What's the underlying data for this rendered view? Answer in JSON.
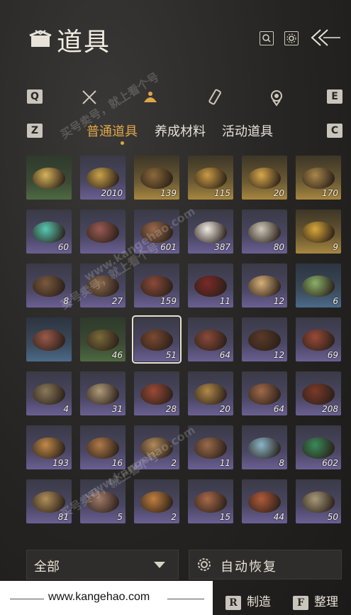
{
  "header": {
    "title": "道具",
    "icons": [
      "inventory-box-icon",
      "search-icon",
      "gear-icon",
      "back-arrow-icon"
    ]
  },
  "categories": {
    "left_key": "Q",
    "right_key": "E",
    "icons": [
      "crossed-swords-icon",
      "pot-icon",
      "scroll-brush-icon",
      "medal-icon"
    ],
    "active_index": 1
  },
  "tabs": {
    "left_key": "Z",
    "right_key": "C",
    "items": [
      "普通道具",
      "养成材料",
      "活动道具"
    ],
    "active_index": 0
  },
  "items": [
    {
      "color": "green",
      "count": "",
      "food": "#d6b35a"
    },
    {
      "color": "purple",
      "count": "2010",
      "food": "#c9a24a"
    },
    {
      "color": "gold",
      "count": "139",
      "food": "#8a6a3a"
    },
    {
      "color": "gold",
      "count": "115",
      "food": "#c89b45"
    },
    {
      "color": "gold",
      "count": "20",
      "food": "#d8a94a"
    },
    {
      "color": "gold",
      "count": "170",
      "food": "#a8874a"
    },
    {
      "color": "purple",
      "count": "60",
      "food": "#58c9b4"
    },
    {
      "color": "purple",
      "count": "",
      "food": "#9a5a55"
    },
    {
      "color": "purple",
      "count": "601",
      "food": "#9a6a4a"
    },
    {
      "color": "purple",
      "count": "387",
      "food": "#eeeae2"
    },
    {
      "color": "purple",
      "count": "80",
      "food": "#cfc8b8"
    },
    {
      "color": "gold",
      "count": "9",
      "food": "#d9a83a"
    },
    {
      "color": "purple",
      "count": "8",
      "food": "#7a5a3e"
    },
    {
      "color": "purple",
      "count": "27",
      "food": "#8a6a4e"
    },
    {
      "color": "purple",
      "count": "159",
      "food": "#8a4a3a"
    },
    {
      "color": "purple",
      "count": "11",
      "food": "#7a2a28"
    },
    {
      "color": "purple",
      "count": "12",
      "food": "#d8b07a"
    },
    {
      "color": "blue",
      "count": "6",
      "food": "#8ab06a"
    },
    {
      "color": "blue",
      "count": "",
      "food": "#9a5a4a"
    },
    {
      "color": "green",
      "count": "46",
      "food": "#7a6a3a"
    },
    {
      "color": "purple",
      "count": "51",
      "food": "#7a4a32",
      "selected": true
    },
    {
      "color": "purple",
      "count": "64",
      "food": "#8a4a3a"
    },
    {
      "color": "purple",
      "count": "12",
      "food": "#5a3a2a"
    },
    {
      "color": "purple",
      "count": "69",
      "food": "#9a4a38"
    },
    {
      "color": "purple",
      "count": "4",
      "food": "#8a7a5a"
    },
    {
      "color": "purple",
      "count": "31",
      "food": "#b09a7a"
    },
    {
      "color": "purple",
      "count": "28",
      "food": "#9a4a38"
    },
    {
      "color": "purple",
      "count": "20",
      "food": "#b08a4a"
    },
    {
      "color": "purple",
      "count": "64",
      "food": "#a06a4a"
    },
    {
      "color": "purple",
      "count": "208",
      "food": "#7a3a2a"
    },
    {
      "color": "purple",
      "count": "193",
      "food": "#c08a4a"
    },
    {
      "color": "purple",
      "count": "16",
      "food": "#b07a4a"
    },
    {
      "color": "purple",
      "count": "2",
      "food": "#b08a5a"
    },
    {
      "color": "purple",
      "count": "11",
      "food": "#9a6a4a"
    },
    {
      "color": "purple",
      "count": "8",
      "food": "#8ab6c8"
    },
    {
      "color": "purple",
      "count": "602",
      "food": "#3a8a5a"
    },
    {
      "color": "purple",
      "count": "81",
      "food": "#b0905a"
    },
    {
      "color": "purple",
      "count": "5",
      "food": "#a07a6a"
    },
    {
      "color": "purple",
      "count": "2",
      "food": "#c08040"
    },
    {
      "color": "purple",
      "count": "15",
      "food": "#a86a4a"
    },
    {
      "color": "purple",
      "count": "44",
      "food": "#b05a3a"
    },
    {
      "color": "purple",
      "count": "50",
      "food": "#a89a7a"
    }
  ],
  "bottom": {
    "filter_label": "全部",
    "auto_label": "自动恢复",
    "footer_url": "www.kangehao.com",
    "craft_key": "R",
    "craft_label": "制造",
    "sort_key": "F",
    "sort_label": "整理"
  },
  "watermark": {
    "line1": "买号卖号，就上看个号",
    "line2": "www.kangehao.com"
  },
  "colors": {
    "accent": "#e0a64a",
    "text": "#e8e2d6"
  }
}
